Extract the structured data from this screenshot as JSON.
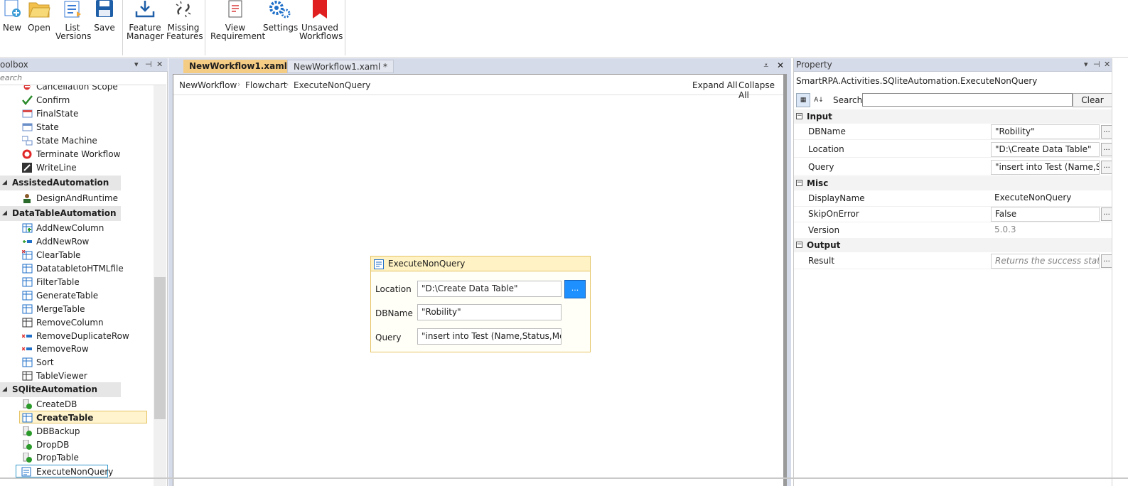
{
  "ribbon": {
    "buttons": [
      {
        "label": "New",
        "icon": "new-icon"
      },
      {
        "label": "Open",
        "icon": "folder-open-icon"
      },
      {
        "label": "List\nVersions",
        "icon": "list-versions-icon"
      },
      {
        "label": "Save",
        "icon": "save-floppy-icon"
      },
      {
        "label": "Feature\nManager",
        "icon": "download-tray-icon"
      },
      {
        "label": "Missing\nFeatures",
        "icon": "broken-link-icon"
      },
      {
        "label": "View\nRequirement",
        "icon": "document-edit-icon"
      },
      {
        "label": "Settings",
        "icon": "gears-icon"
      },
      {
        "label": "Unsaved\nWorkflows",
        "icon": "red-bookmark-icon"
      }
    ]
  },
  "toolbox": {
    "title": "oolbox",
    "search_placeholder": "earch",
    "items": [
      {
        "type": "item",
        "label": "Cancellation Scope",
        "icon": "cancel-scope-icon"
      },
      {
        "type": "item",
        "label": "Confirm",
        "icon": "checkmark-icon"
      },
      {
        "type": "item",
        "label": "FinalState",
        "icon": "final-state-icon"
      },
      {
        "type": "item",
        "label": "State",
        "icon": "state-icon"
      },
      {
        "type": "item",
        "label": "State Machine",
        "icon": "state-machine-icon"
      },
      {
        "type": "item",
        "label": "Terminate Workflow",
        "icon": "stop-icon"
      },
      {
        "type": "item",
        "label": "WriteLine",
        "icon": "writeline-icon"
      },
      {
        "type": "category",
        "label": "AssistedAutomation"
      },
      {
        "type": "item",
        "label": "DesignAndRuntime",
        "icon": "person-icon"
      },
      {
        "type": "category",
        "label": "DataTableAutomation"
      },
      {
        "type": "item",
        "label": "AddNewColumn",
        "icon": "table-add-icon"
      },
      {
        "type": "item",
        "label": "AddNewRow",
        "icon": "row-add-icon"
      },
      {
        "type": "item",
        "label": "ClearTable",
        "icon": "table-clear-icon"
      },
      {
        "type": "item",
        "label": "DatatabletoHTMLfile",
        "icon": "table-html-icon"
      },
      {
        "type": "item",
        "label": "FilterTable",
        "icon": "table-filter-icon"
      },
      {
        "type": "item",
        "label": "GenerateTable",
        "icon": "table-generate-icon"
      },
      {
        "type": "item",
        "label": "MergeTable",
        "icon": "table-merge-icon"
      },
      {
        "type": "item",
        "label": "RemoveColumn",
        "icon": "column-remove-icon"
      },
      {
        "type": "item",
        "label": "RemoveDuplicateRow",
        "icon": "row-remove-icon"
      },
      {
        "type": "item",
        "label": "RemoveRow",
        "icon": "row-remove-icon"
      },
      {
        "type": "item",
        "label": "Sort",
        "icon": "table-sort-icon"
      },
      {
        "type": "item",
        "label": "TableViewer",
        "icon": "table-view-icon"
      },
      {
        "type": "category",
        "label": "SQliteAutomation"
      },
      {
        "type": "item",
        "label": "CreateDB",
        "icon": "db-create-icon"
      },
      {
        "type": "item",
        "label": "CreateTable",
        "icon": "table-create-icon",
        "state": "hover"
      },
      {
        "type": "item",
        "label": "DBBackup",
        "icon": "db-backup-icon"
      },
      {
        "type": "item",
        "label": "DropDB",
        "icon": "db-drop-icon"
      },
      {
        "type": "item",
        "label": "DropTable",
        "icon": "table-drop-icon"
      },
      {
        "type": "item",
        "label": "ExecuteNonQuery",
        "icon": "query-icon",
        "state": "selected"
      }
    ]
  },
  "designer": {
    "tabs": [
      {
        "label": "NewWorkflow1.xaml *",
        "active": true
      },
      {
        "label": "NewWorkflow1.xaml *",
        "active": false
      }
    ],
    "breadcrumb": [
      "NewWorkflow",
      "Flowchart",
      "ExecuteNonQuery"
    ],
    "expand_all": "Expand All",
    "collapse_all": "Collapse All",
    "activity": {
      "title": "ExecuteNonQuery",
      "location_label": "Location",
      "location_value": "\"D:\\Create Data Table\"",
      "dbname_label": "DBName",
      "dbname_value": "\"Robility\"",
      "query_label": "Query",
      "query_value": "\"insert into Test (Name,Status,Mobile",
      "browse_label": "..."
    }
  },
  "property": {
    "title": "Property",
    "type_name": "SmartRPA.Activities.SQliteAutomation.ExecuteNonQuery",
    "search_label": "Search:",
    "clear_label": "Clear",
    "categories": [
      {
        "name": "Input",
        "rows": [
          {
            "name": "DBName",
            "value": "\"Robility\"",
            "style": "box",
            "button": "..."
          },
          {
            "name": "Location",
            "value": "\"D:\\Create Data Table\"",
            "style": "box",
            "button": "..."
          },
          {
            "name": "Query",
            "value": "\"insert into Test (Name,Stat",
            "style": "box",
            "button": "..."
          }
        ]
      },
      {
        "name": "Misc",
        "rows": [
          {
            "name": "DisplayName",
            "value": "ExecuteNonQuery",
            "style": "plain",
            "button": ""
          },
          {
            "name": "SkipOnError",
            "value": "False",
            "style": "box",
            "button": "..."
          },
          {
            "name": "Version",
            "value": "5.0.3",
            "style": "gray",
            "button": ""
          }
        ]
      },
      {
        "name": "Output",
        "rows": [
          {
            "name": "Result",
            "value": "Returns the success state of",
            "style": "hint",
            "button": "..."
          }
        ]
      }
    ]
  },
  "colors": {
    "selection_yellow": "#fff4ce",
    "activity_border": "#e5c365",
    "browse_blue": "#1e90ff",
    "pane_header": "#d6dbe9"
  }
}
